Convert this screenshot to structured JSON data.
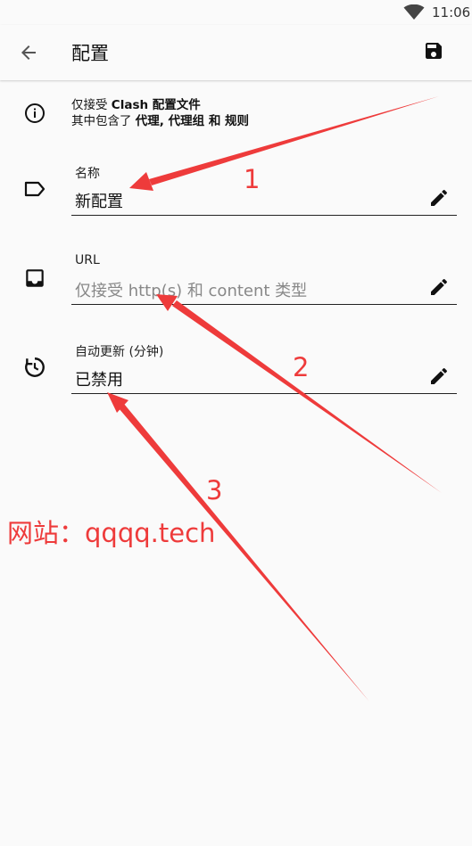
{
  "status_bar": {
    "time": "11:06"
  },
  "app_bar": {
    "title": "配置"
  },
  "info": {
    "line1_prefix": "仅接受 ",
    "line1_bold": "Clash 配置文件",
    "line2_prefix": "其中包含了 ",
    "line2_bold": "代理, 代理组 和 规则"
  },
  "fields": [
    {
      "label": "名称",
      "value": "新配置",
      "placeholder": false
    },
    {
      "label": "URL",
      "value": "仅接受 http(s) 和 content 类型",
      "placeholder": true
    },
    {
      "label": "自动更新 (分钟)",
      "value": "已禁用",
      "placeholder": false
    }
  ],
  "annotations": {
    "numbers": [
      "1",
      "2",
      "3"
    ],
    "watermark": "网站：qqqq.tech",
    "color": "#ee3b3b"
  }
}
